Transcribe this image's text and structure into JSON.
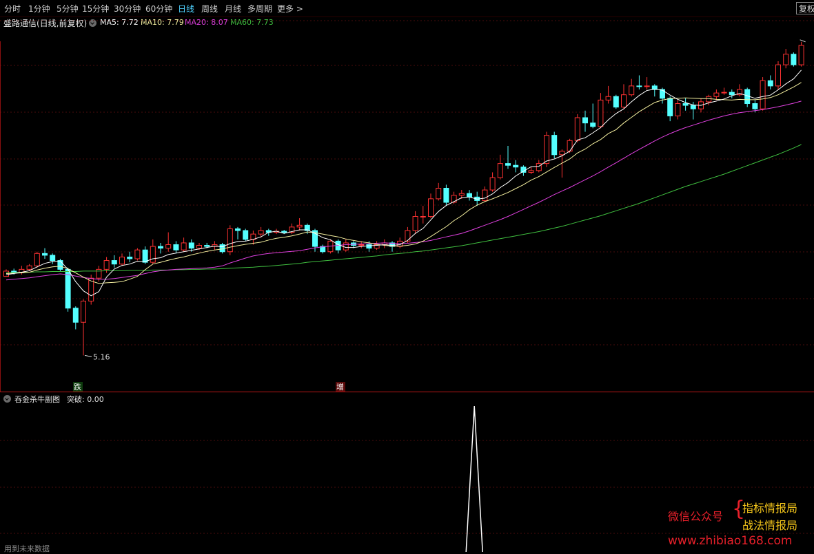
{
  "toolbar": {
    "tabs": [
      "分时",
      "1分钟",
      "5分钟",
      "15分钟",
      "30分钟",
      "60分钟",
      "日线",
      "周线",
      "月线",
      "多周期",
      "更多 >"
    ],
    "active": "日线",
    "restore_label": "复权"
  },
  "main_legend": {
    "title": "盛路通信(日线,前复权)",
    "ma5": "MA5: 7.72",
    "ma10": "MA10: 7.79",
    "ma20": "MA20: 8.07",
    "ma60": "MA60: 7.73",
    "colors": {
      "ma5": "#ffffff",
      "ma10": "#f5f0a0",
      "ma20": "#e040e0",
      "ma60": "#40c040"
    }
  },
  "markers": {
    "low_label": "5.16",
    "signal_die": "跌",
    "signal_zeng": "增"
  },
  "sub_legend": {
    "title": "吞金杀牛副图",
    "value": "突破: 0.00"
  },
  "footer_note": "用到未来数据",
  "watermark": {
    "label": "微信公众号",
    "line1": "指标情报局",
    "line2": "战法情报局",
    "url": "www.zhibiao168.com"
  },
  "icons": [
    "collapse-toggle-icon"
  ],
  "chart_data": [
    {
      "type": "candlestick",
      "title": "盛路通信(日线,前复权)",
      "colors": {
        "up": "#ff3232",
        "down": "#54ffff"
      },
      "ohlc": [
        [
          7.4,
          7.55,
          7.5,
          7.6
        ],
        [
          7.55,
          7.5,
          7.45,
          7.62
        ],
        [
          7.5,
          7.6,
          7.45,
          7.7
        ],
        [
          7.6,
          7.7,
          7.55,
          7.75
        ],
        [
          7.7,
          8.05,
          7.65,
          8.1
        ],
        [
          8.05,
          8.0,
          7.9,
          8.2
        ],
        [
          8.0,
          7.85,
          7.75,
          8.05
        ],
        [
          7.85,
          7.6,
          7.55,
          7.9
        ],
        [
          7.6,
          6.5,
          6.4,
          7.65
        ],
        [
          6.5,
          6.1,
          5.9,
          6.55
        ],
        [
          6.1,
          6.7,
          5.16,
          6.75
        ],
        [
          6.7,
          7.35,
          6.6,
          7.45
        ],
        [
          7.35,
          7.6,
          7.25,
          7.7
        ],
        [
          7.6,
          7.85,
          7.5,
          7.95
        ],
        [
          7.85,
          7.75,
          7.65,
          8.0
        ],
        [
          7.75,
          7.95,
          7.7,
          8.05
        ],
        [
          7.95,
          7.9,
          7.8,
          8.1
        ],
        [
          7.9,
          8.15,
          7.85,
          8.2
        ],
        [
          8.15,
          7.8,
          7.75,
          8.25
        ],
        [
          7.8,
          8.25,
          7.75,
          8.45
        ],
        [
          8.25,
          8.2,
          8.05,
          8.35
        ],
        [
          8.2,
          8.3,
          8.1,
          8.65
        ],
        [
          8.3,
          8.15,
          8.05,
          8.4
        ],
        [
          8.15,
          8.35,
          8.1,
          8.5
        ],
        [
          8.35,
          8.2,
          8.1,
          8.45
        ],
        [
          8.2,
          8.28,
          8.15,
          8.35
        ],
        [
          8.28,
          8.25,
          8.2,
          8.35
        ],
        [
          8.25,
          8.3,
          8.15,
          8.4
        ],
        [
          8.3,
          8.1,
          8.05,
          8.35
        ],
        [
          8.1,
          8.75,
          8.0,
          8.85
        ],
        [
          8.75,
          8.7,
          8.45,
          8.8
        ],
        [
          8.7,
          8.45,
          8.4,
          8.75
        ],
        [
          8.45,
          8.6,
          8.3,
          8.7
        ],
        [
          8.6,
          8.7,
          8.5,
          8.8
        ],
        [
          8.7,
          8.65,
          8.55,
          8.75
        ],
        [
          8.65,
          8.68,
          8.6,
          8.75
        ],
        [
          8.68,
          8.65,
          8.6,
          8.72
        ],
        [
          8.65,
          8.8,
          8.6,
          8.9
        ],
        [
          8.8,
          8.85,
          8.7,
          9.05
        ],
        [
          8.85,
          8.7,
          8.6,
          8.9
        ],
        [
          8.7,
          8.25,
          8.1,
          8.75
        ],
        [
          8.25,
          8.1,
          8.05,
          8.3
        ],
        [
          8.1,
          8.4,
          8.05,
          8.45
        ],
        [
          8.4,
          8.15,
          8.05,
          8.45
        ],
        [
          8.15,
          8.35,
          8.1,
          8.45
        ],
        [
          8.35,
          8.28,
          8.2,
          8.4
        ],
        [
          8.28,
          8.3,
          8.2,
          8.4
        ],
        [
          8.3,
          8.2,
          8.1,
          8.4
        ],
        [
          8.2,
          8.3,
          8.15,
          8.4
        ],
        [
          8.3,
          8.35,
          8.2,
          8.45
        ],
        [
          8.35,
          8.25,
          8.1,
          8.4
        ],
        [
          8.25,
          8.4,
          8.2,
          8.5
        ],
        [
          8.4,
          8.7,
          8.35,
          8.8
        ],
        [
          8.7,
          9.1,
          8.6,
          9.25
        ],
        [
          9.1,
          9.1,
          8.9,
          9.4
        ],
        [
          9.1,
          9.6,
          9.05,
          9.75
        ],
        [
          9.6,
          9.9,
          9.55,
          10.05
        ],
        [
          9.9,
          9.5,
          9.4,
          10.0
        ],
        [
          9.5,
          9.7,
          9.45,
          9.8
        ],
        [
          9.7,
          9.75,
          9.6,
          9.85
        ],
        [
          9.75,
          9.65,
          9.55,
          9.85
        ],
        [
          9.65,
          9.55,
          9.4,
          9.8
        ],
        [
          9.55,
          9.85,
          9.5,
          9.95
        ],
        [
          9.85,
          10.2,
          9.8,
          10.35
        ],
        [
          10.2,
          10.6,
          10.15,
          10.85
        ],
        [
          10.6,
          10.55,
          10.45,
          11.1
        ],
        [
          10.55,
          10.5,
          10.35,
          10.7
        ],
        [
          10.5,
          10.35,
          10.25,
          10.55
        ],
        [
          10.35,
          10.4,
          10.3,
          10.5
        ],
        [
          10.4,
          10.6,
          10.35,
          10.7
        ],
        [
          10.6,
          11.4,
          10.5,
          11.5
        ],
        [
          11.4,
          10.85,
          10.75,
          11.5
        ],
        [
          10.85,
          10.95,
          10.2,
          11.0
        ],
        [
          10.95,
          11.25,
          10.9,
          11.3
        ],
        [
          11.25,
          11.9,
          11.2,
          12.0
        ],
        [
          11.9,
          11.75,
          11.5,
          12.1
        ],
        [
          11.75,
          11.65,
          11.6,
          12.3
        ],
        [
          11.65,
          12.4,
          11.6,
          12.6
        ],
        [
          12.4,
          12.5,
          12.3,
          12.8
        ],
        [
          12.5,
          12.2,
          12.15,
          12.55
        ],
        [
          12.2,
          12.55,
          12.15,
          12.85
        ],
        [
          12.55,
          12.8,
          12.5,
          13.0
        ],
        [
          12.8,
          12.78,
          12.7,
          13.1
        ],
        [
          12.78,
          12.8,
          12.7,
          13.05
        ],
        [
          12.8,
          12.7,
          12.5,
          12.85
        ],
        [
          12.7,
          12.45,
          12.3,
          12.75
        ],
        [
          12.45,
          11.95,
          11.8,
          12.5
        ],
        [
          11.95,
          12.3,
          11.85,
          12.4
        ],
        [
          12.3,
          12.25,
          12.1,
          12.45
        ],
        [
          12.25,
          12.15,
          11.85,
          12.35
        ],
        [
          12.15,
          12.35,
          12.05,
          12.45
        ],
        [
          12.35,
          12.5,
          12.25,
          12.55
        ],
        [
          12.5,
          12.6,
          12.4,
          12.7
        ],
        [
          12.6,
          12.62,
          12.55,
          12.75
        ],
        [
          12.62,
          12.55,
          12.45,
          12.7
        ],
        [
          12.55,
          12.7,
          12.5,
          12.85
        ],
        [
          12.7,
          12.3,
          12.2,
          12.75
        ],
        [
          12.3,
          12.15,
          12.05,
          12.4
        ],
        [
          12.15,
          12.95,
          12.1,
          13.05
        ],
        [
          12.95,
          12.8,
          12.7,
          13.1
        ],
        [
          12.8,
          13.4,
          12.7,
          13.5
        ],
        [
          13.4,
          13.7,
          13.3,
          13.85
        ],
        [
          13.7,
          13.4,
          13.35,
          13.75
        ],
        [
          13.4,
          13.95,
          13.35,
          14.05
        ]
      ],
      "ma5": [
        7.45,
        7.48,
        7.52,
        7.56,
        7.67,
        7.77,
        7.82,
        7.84,
        7.6,
        7.25,
        6.99,
        6.85,
        6.97,
        7.38,
        7.61,
        7.71,
        7.75,
        7.83,
        7.82,
        7.9,
        7.93,
        8.02,
        8.06,
        8.1,
        8.14,
        8.18,
        8.22,
        8.26,
        8.24,
        8.33,
        8.39,
        8.4,
        8.45,
        8.52,
        8.65,
        8.68,
        8.62,
        8.67,
        8.72,
        8.72,
        8.62,
        8.5,
        8.44,
        8.3,
        8.22,
        8.22,
        8.25,
        8.27,
        8.28,
        8.3,
        8.28,
        8.3,
        8.42,
        8.62,
        8.76,
        9.0,
        9.24,
        9.41,
        9.52,
        9.63,
        9.65,
        9.59,
        9.62,
        9.74,
        9.92,
        10.06,
        10.25,
        10.38,
        10.51,
        10.52,
        10.67,
        10.73,
        10.82,
        10.95,
        11.27,
        11.33,
        11.47,
        11.62,
        11.84,
        12.02,
        12.15,
        12.35,
        12.53,
        12.67,
        12.71,
        12.68,
        12.54,
        12.42,
        12.33,
        12.26,
        12.25,
        12.32,
        12.37,
        12.43,
        12.52,
        12.59,
        12.52,
        12.45,
        12.5,
        12.54,
        12.69,
        12.86,
        13.0,
        13.25
      ],
      "ma10": [
        7.48,
        7.49,
        7.5,
        7.52,
        7.58,
        7.63,
        7.67,
        7.69,
        7.62,
        7.5,
        7.38,
        7.27,
        7.2,
        7.22,
        7.23,
        7.25,
        7.32,
        7.4,
        7.59,
        7.75,
        7.8,
        7.86,
        7.91,
        7.95,
        8.01,
        8.06,
        8.11,
        8.15,
        8.18,
        8.23,
        8.27,
        8.31,
        8.34,
        8.37,
        8.43,
        8.48,
        8.51,
        8.55,
        8.6,
        8.66,
        8.64,
        8.6,
        8.56,
        8.52,
        8.46,
        8.42,
        8.38,
        8.35,
        8.31,
        8.28,
        8.26,
        8.26,
        8.28,
        8.32,
        8.4,
        8.53,
        8.67,
        8.81,
        8.98,
        9.12,
        9.29,
        9.42,
        9.52,
        9.6,
        9.69,
        9.78,
        9.89,
        10.0,
        10.13,
        10.23,
        10.36,
        10.49,
        10.61,
        10.73,
        10.9,
        11.01,
        11.16,
        11.28,
        11.45,
        11.56,
        11.75,
        11.91,
        12.07,
        12.2,
        12.33,
        12.4,
        12.44,
        12.45,
        12.46,
        12.45,
        12.44,
        12.44,
        12.42,
        12.41,
        12.4,
        12.42,
        12.41,
        12.41,
        12.43,
        12.47,
        12.55,
        12.66,
        12.77,
        12.9
      ],
      "ma20": [
        7.3,
        7.32,
        7.34,
        7.36,
        7.39,
        7.42,
        7.45,
        7.47,
        7.45,
        7.41,
        7.37,
        7.34,
        7.32,
        7.32,
        7.34,
        7.37,
        7.4,
        7.43,
        7.48,
        7.53,
        7.56,
        7.58,
        7.6,
        7.61,
        7.62,
        7.63,
        7.64,
        7.66,
        7.7,
        7.78,
        7.85,
        7.92,
        7.98,
        8.02,
        8.05,
        8.07,
        8.09,
        8.11,
        8.13,
        8.17,
        8.21,
        8.24,
        8.26,
        8.28,
        8.3,
        8.31,
        8.32,
        8.33,
        8.34,
        8.35,
        8.34,
        8.33,
        8.34,
        8.36,
        8.38,
        8.42,
        8.47,
        8.52,
        8.57,
        8.62,
        8.69,
        8.77,
        8.85,
        8.93,
        9.01,
        9.1,
        9.2,
        9.3,
        9.4,
        9.5,
        9.61,
        9.72,
        9.82,
        9.92,
        10.03,
        10.14,
        10.25,
        10.37,
        10.5,
        10.62,
        10.75,
        10.88,
        11.0,
        11.12,
        11.24,
        11.35,
        11.45,
        11.54,
        11.62,
        11.69,
        11.76,
        11.83,
        11.89,
        11.95,
        12.0,
        12.04,
        12.07,
        12.1,
        12.13,
        12.17,
        12.21,
        12.26,
        12.31,
        12.37
      ],
      "ma60": [
        7.51,
        7.51,
        7.52,
        7.52,
        7.53,
        7.53,
        7.54,
        7.54,
        7.54,
        7.54,
        7.55,
        7.55,
        7.55,
        7.56,
        7.56,
        7.56,
        7.57,
        7.57,
        7.57,
        7.58,
        7.58,
        7.58,
        7.59,
        7.59,
        7.6,
        7.6,
        7.61,
        7.61,
        7.62,
        7.63,
        7.64,
        7.65,
        7.66,
        7.68,
        7.69,
        7.71,
        7.73,
        7.75,
        7.77,
        7.8,
        7.82,
        7.84,
        7.86,
        7.88,
        7.9,
        7.92,
        7.94,
        7.96,
        7.98,
        8.01,
        8.03,
        8.05,
        8.07,
        8.1,
        8.12,
        8.15,
        8.18,
        8.21,
        8.24,
        8.27,
        8.31,
        8.35,
        8.39,
        8.43,
        8.47,
        8.51,
        8.55,
        8.59,
        8.63,
        8.67,
        8.72,
        8.77,
        8.82,
        8.88,
        8.94,
        9.0,
        9.06,
        9.12,
        9.19,
        9.26,
        9.33,
        9.4,
        9.47,
        9.55,
        9.63,
        9.71,
        9.79,
        9.87,
        9.95,
        10.02,
        10.09,
        10.16,
        10.23,
        10.3,
        10.38,
        10.46,
        10.54,
        10.62,
        10.7,
        10.78,
        10.86,
        10.95,
        11.04,
        11.14
      ],
      "ylim": [
        4.7,
        14.3
      ],
      "grid": true
    },
    {
      "type": "line",
      "title": "吞金杀牛副图",
      "series": [
        {
          "name": "突破",
          "color": "#ffffff",
          "spike_index": 66,
          "spike_value": 1,
          "base_value": 0
        }
      ],
      "ylim": [
        0,
        1
      ],
      "grid": true
    }
  ]
}
